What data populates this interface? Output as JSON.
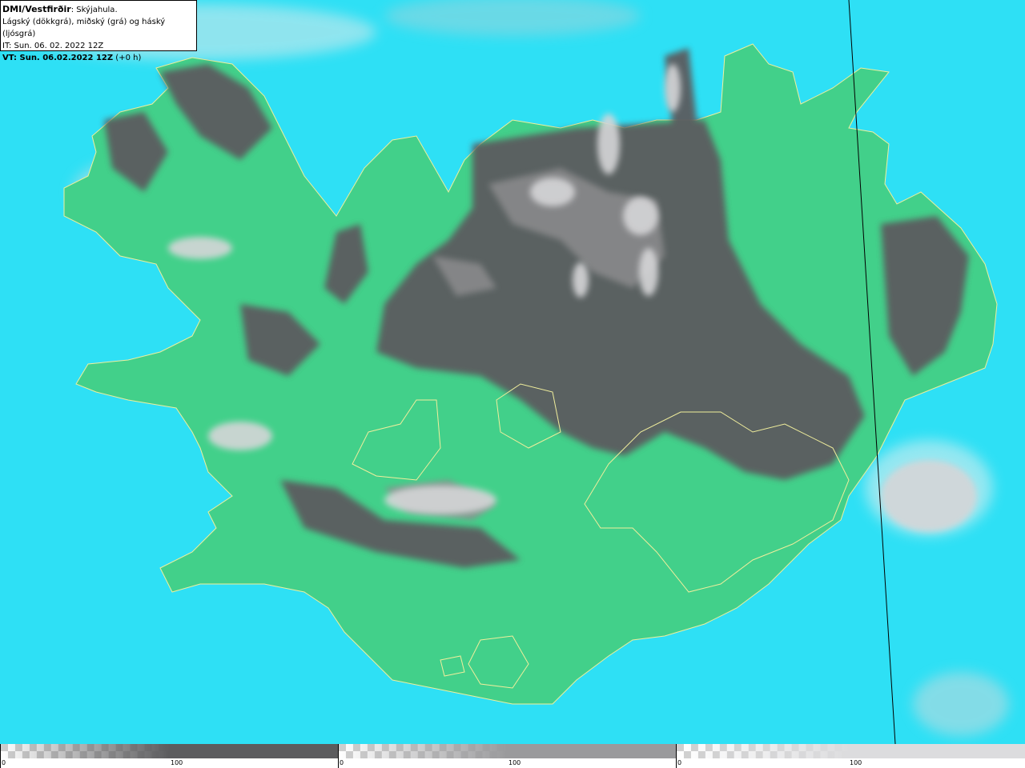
{
  "header": {
    "title": "DMI/Vestfirðir",
    "subtitle": ": Skýjahula.",
    "description": "Lágský (dökkgrá), miðský (grá) og háský (ljósgrá)",
    "issue_time": "IT: Sun. 06. 02. 2022 12Z",
    "valid_time": "VT: Sun. 06.02.2022 12Z",
    "valid_offset": " (+0 h)"
  },
  "map": {
    "region": "Iceland",
    "colors": {
      "sea": "#2ee0f5",
      "land": "#42d08a",
      "low_cloud": "#5c5c5e",
      "mid_cloud": "#8c8c8e",
      "high_cloud": "#d6d6d8",
      "coastline": "#f0ee9c"
    }
  },
  "legend": {
    "segments": [
      {
        "name": "low-cloud",
        "min_label": "0",
        "mid_label": "100",
        "color": "#5c5c5e"
      },
      {
        "name": "mid-cloud",
        "min_label": "0",
        "mid_label": "100",
        "color": "#9a9a9c"
      },
      {
        "name": "high-cloud",
        "min_label": "0",
        "mid_label": "100",
        "color": "#dcdcde"
      }
    ]
  }
}
